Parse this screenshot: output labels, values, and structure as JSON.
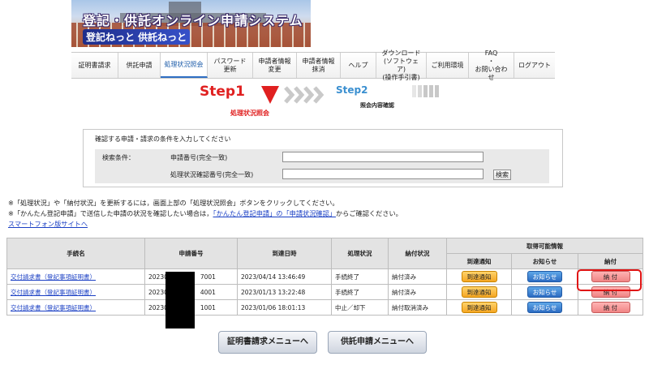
{
  "header": {
    "title": "登記・供託オンライン申請システム",
    "subtitle": "登記ねっと 供託ねっと"
  },
  "nav": {
    "items": [
      {
        "label": "証明書請求",
        "active": false
      },
      {
        "label": "供託申請",
        "active": false
      },
      {
        "label": "処理状況照会",
        "active": true
      },
      {
        "label": "パスワード\n更新",
        "active": false
      },
      {
        "label": "申請者情報\n変更",
        "active": false
      },
      {
        "label": "申請者情報\n抹消",
        "active": false
      },
      {
        "label": "ヘルプ",
        "active": false
      },
      {
        "label": "ダウンロード\n(ソフトウェア)\n(操作手引書)",
        "active": false
      },
      {
        "label": "ご利用環境",
        "active": false
      },
      {
        "label": "FAQ\n・\nお問い合わせ",
        "active": false
      },
      {
        "label": "ログアウト",
        "active": false
      }
    ]
  },
  "steps": {
    "step1": "Step1",
    "step1_label": "処理状況照会",
    "step2": "Step2",
    "step2_label": "照会内容確認"
  },
  "search": {
    "instruction": "確認する申請・請求の条件を入力してください",
    "condition_label": "検索条件：",
    "field1_label": "申請番号(完全一致)",
    "field1_value": "",
    "field2_label": "処理状況確認番号(完全一致)",
    "field2_value": "",
    "button": "検索"
  },
  "notes": {
    "line1": "※「処理状況」や「納付状況」を更新するには，画面上部の「処理状況照会」ボタンをクリックしてください。",
    "line2_pre": "※「かんたん登記申請」で送信した申請の状況を確認したい場合は，",
    "line2_link": "「かんたん登記申請」の「申請状況確認」",
    "line2_post": "からご確認ください。",
    "smartphone_link": "スマートフォン版サイトへ"
  },
  "table": {
    "headers": {
      "name": "手続名",
      "number": "申請番号",
      "arrival": "到達日時",
      "status": "処理状況",
      "payment": "納付状況",
      "available": "取得可能情報",
      "arrival_notice": "到達通知",
      "info": "お知らせ",
      "pay": "納付"
    },
    "rows": [
      {
        "name": "交付請求書（登記事項証明書）",
        "number_prefix": "20230",
        "number_suffix": "7001",
        "arrival": "2023/04/14 13:46:49",
        "status": "手続終了",
        "payment": "納付済み",
        "btn_notice": "到達通知",
        "btn_info": "お知らせ",
        "btn_pay": "納 付"
      },
      {
        "name": "交付請求書（登記事項証明書）",
        "number_prefix": "20230",
        "number_suffix": "4001",
        "arrival": "2023/01/13 13:22:48",
        "status": "手続終了",
        "payment": "納付済み",
        "btn_notice": "到達通知",
        "btn_info": "お知らせ",
        "btn_pay": "納 付"
      },
      {
        "name": "交付請求書（登記事項証明書）",
        "number_prefix": "20230",
        "number_suffix": "1001",
        "arrival": "2023/01/06 18:01:13",
        "status": "中止／却下",
        "payment": "納付取消済み",
        "btn_notice": "到達通知",
        "btn_info": "お知らせ",
        "btn_pay": "納 付"
      }
    ]
  },
  "bottom": {
    "cert_menu": "証明書請求メニューへ",
    "deposit_menu": "供託申請メニューへ"
  },
  "colors": {
    "step1": "#e02020",
    "step2": "#3a8fd0",
    "link": "#1a3fc4",
    "highlight": "#e01414"
  }
}
